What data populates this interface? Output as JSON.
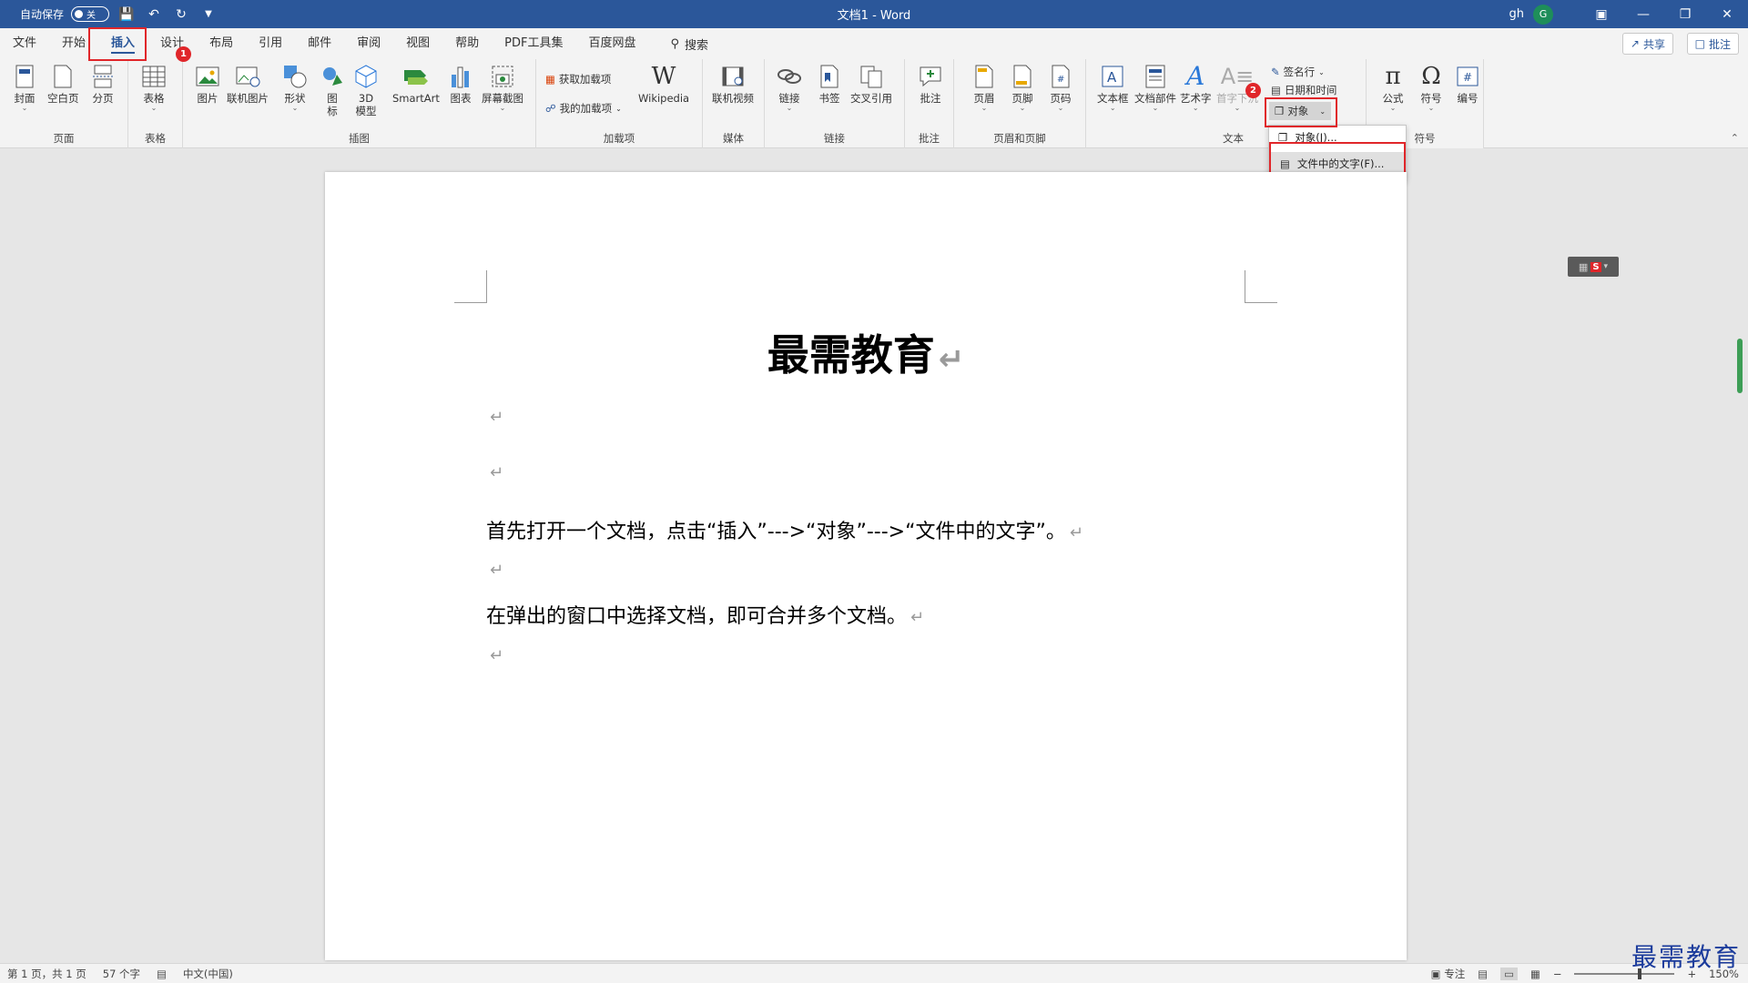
{
  "titlebar": {
    "autosave_label": "自动保存",
    "autosave_state": "关",
    "doc_title": "文档1  -  Word",
    "user_name": "gh",
    "avatar_letter": "G"
  },
  "tabs": [
    "文件",
    "开始",
    "插入",
    "设计",
    "布局",
    "引用",
    "邮件",
    "审阅",
    "视图",
    "帮助",
    "PDF工具集",
    "百度网盘"
  ],
  "active_tab": "插入",
  "search_label": "搜索",
  "share_label": "共享",
  "comment_label": "批注",
  "ribbon": {
    "pages": {
      "label": "页面",
      "cover": "封面",
      "blank": "空白页",
      "break": "分页"
    },
    "tables": {
      "label": "表格",
      "table": "表格"
    },
    "illustrations": {
      "label": "插图",
      "picture": "图片",
      "online_picture": "联机图片",
      "shapes": "形状",
      "icons": "图\n标",
      "model3d": "3D\n模型",
      "smartart": "SmartArt",
      "chart": "图表",
      "screenshot": "屏幕截图"
    },
    "addins": {
      "label": "加载项",
      "get": "获取加载项",
      "my": "我的加载项",
      "wikipedia": "Wikipedia"
    },
    "media": {
      "label": "媒体",
      "video": "联机视频"
    },
    "links": {
      "label": "链接",
      "link": "链接",
      "bookmark": "书签",
      "crossref": "交叉引用"
    },
    "comments": {
      "label": "批注",
      "comment": "批注"
    },
    "header_footer": {
      "label": "页眉和页脚",
      "header": "页眉",
      "footer": "页脚",
      "page_number": "页码"
    },
    "text": {
      "label": "文本",
      "textbox": "文本框",
      "quickparts": "文档部件",
      "wordart": "艺术字",
      "dropcap": "首字下沉",
      "signature": "签名行",
      "datetime": "日期和时间",
      "object": "对象"
    },
    "symbols": {
      "label": "符号",
      "equation": "公式",
      "symbol": "符号",
      "number": "编号"
    }
  },
  "dropdown": {
    "item1": "对象(J)...",
    "item2": "文件中的文字(F)..."
  },
  "badges": [
    "1",
    "2",
    "3"
  ],
  "document": {
    "title": "最需教育",
    "pilcrow": "↵",
    "para1": "首先打开一个文档，点击“插入”--->“对象”--->“文件中的文字”。",
    "para2": "在弹出的窗口中选择文档，即可合并多个文档。"
  },
  "statusbar": {
    "page": "第 1 页，共 1 页",
    "words": "57 个字",
    "language": "中文(中国)",
    "focus": "专注",
    "zoom": "150%"
  },
  "watermark": "最需教育",
  "colors": {
    "titlebar": "#2b579a",
    "highlight": "#e0262a"
  }
}
